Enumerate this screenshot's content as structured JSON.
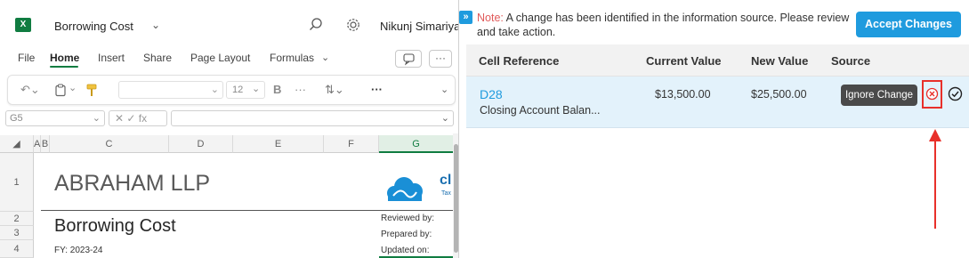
{
  "excel": {
    "app_badge": "X",
    "doc_title": "Borrowing Cost",
    "user_name": "Nikunj Simariya",
    "menu": [
      "File",
      "Home",
      "Insert",
      "Share",
      "Page Layout",
      "Formulas"
    ],
    "font_size": "12",
    "name_box": "G5",
    "fx_symbols": "✕ ✓ fx",
    "columns": [
      "A",
      "B",
      "C",
      "D",
      "E",
      "F",
      "G"
    ],
    "rows": [
      "1",
      "2",
      "3",
      "4"
    ],
    "company": "ABRAHAM LLP",
    "sheet_heading": "Borrowing Cost",
    "fy": "FY: 2023-24",
    "reviewed_by": "Reviewed by:",
    "prepared_by": "Prepared by:",
    "updated_on": "Updated on:",
    "logo_text": "cl",
    "logo_sub": "Tax"
  },
  "panel": {
    "collapse_icon": "»",
    "note_label": "Note:",
    "note_text": " A change has been identified in the information source. Please review and take action.",
    "accept_all_label": "Accept Changes",
    "headers": {
      "cell_reference": "Cell Reference",
      "current_value": "Current Value",
      "new_value": "New Value",
      "source": "Source"
    },
    "rows": [
      {
        "cell": "D28",
        "description": "Closing Account Balan...",
        "current_value": "$13,500.00",
        "new_value": "$25,500.00",
        "tooltip": "Ignore Change"
      }
    ]
  },
  "colors": {
    "excel_green": "#107c41",
    "accent_blue": "#1f9bde",
    "highlight_red": "#e8302a",
    "row_highlight": "#e3f2fb"
  }
}
